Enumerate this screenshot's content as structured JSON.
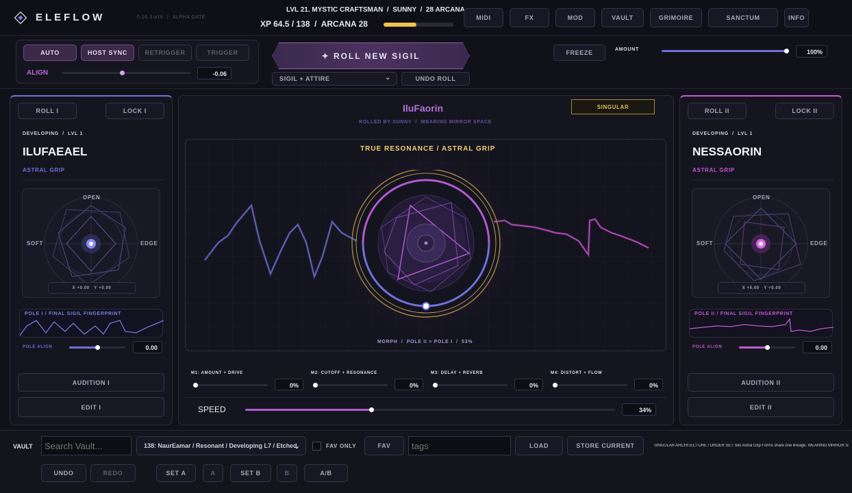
{
  "header": {
    "brand": "ELEFLOW",
    "version": "0.16.3-a16",
    "stage": "ALPHA GATE",
    "status_line": "LVL 21. MYSTIC CRAFTSMAN  /  SUNNY  /  28 ARCANA",
    "xp_line": "XP 64.5 / 138  /  ARCANA 28",
    "xp_progress": 0.467,
    "nav": [
      "MIDI",
      "FX",
      "MOD",
      "VAULT",
      "GRIMOIRE",
      "SANCTUM",
      "INFO"
    ]
  },
  "controls": {
    "auto": "AUTO",
    "host_sync": "HOST SYNC",
    "retrigger": "RETRIGGER",
    "trigger": "TRIGGER",
    "align_label": "ALIGN",
    "align_value": "-0.06",
    "align_level": 0.47,
    "roll_button": "✦ ROLL NEW SIGIL",
    "roll_mode": "SIGIL + ATTIRE",
    "undo_roll": "UNDO ROLL",
    "freeze": "FREEZE",
    "amount_label": "AMOUNT",
    "amount_value": "100%",
    "amount_level": 1.0
  },
  "pole_left": {
    "roll": "ROLL I",
    "lock": "LOCK I",
    "stage": "DEVELOPING  /  LVL 1",
    "name": "ILUFAEAEL",
    "form": "ASTRAL GRIP",
    "axis_top": "OPEN",
    "axis_left": "SOFT",
    "axis_right": "EDGE",
    "coords": "X +0.00   Y +0.00",
    "fingerprint_label": "POLE I / FINAL SIGIL FINGERPRINT",
    "pole_align_label": "POLE ALIGN",
    "pole_align_value": "0.00",
    "pole_align_level": 0.5,
    "audition": "AUDITION I",
    "edit": "EDIT I",
    "color": "#6f72d8"
  },
  "pole_right": {
    "roll": "ROLL II",
    "lock": "LOCK II",
    "stage": "DEVELOPING  /  LVL 1",
    "name": "NESSAORIN",
    "form": "ASTRAL GRIP",
    "axis_top": "OPEN",
    "axis_left": "SOFT",
    "axis_right": "EDGE",
    "coords": "X +0.00   Y +0.00",
    "fingerprint_label": "POLE II / FINAL SIGIL FINGERPRINT",
    "pole_align_label": "POLE ALIGN",
    "pole_align_value": "0.00",
    "pole_align_level": 0.5,
    "audition": "AUDITION II",
    "edit": "EDIT II",
    "color": "#c45ad2"
  },
  "center": {
    "title": "IluFaorin",
    "badge": "SINGULAR",
    "subtitle": "ROLLED BY SUNNY  /  WEARING MIRROR SPACE",
    "resonance": "TRUE RESONANCE / ASTRAL GRIP",
    "morph_line": "MORPH  /  POLE II > POLE I  /  53%",
    "morph_level": 0.53,
    "macros": [
      {
        "label": "M1: AMOUNT + DRIVE",
        "value": "0%",
        "level": 0
      },
      {
        "label": "M2: CUTOFF + RESONANCE",
        "value": "0%",
        "level": 0
      },
      {
        "label": "M3: DELAY + REVERB",
        "value": "0%",
        "level": 0
      },
      {
        "label": "M4: DISTORT + FLOW",
        "value": "0%",
        "level": 0
      }
    ],
    "speed_label": "SPEED",
    "speed_value": "34%",
    "speed_level": 0.34
  },
  "footer": {
    "vault_label": "VAULT",
    "search_placeholder": "Search Vault...",
    "preset": "138: NaurEamar / Resonant / Developing L7 / Etched",
    "fav_only": "FAV ONLY",
    "fav": "FAV",
    "tags_placeholder": "tags",
    "load": "LOAD",
    "store": "STORE CURRENT",
    "info": "SINGULAR ARCHITECTURE / ORDER SET: two Astral Grip Forms share one lineage. WEARING MIRROR SPACE.",
    "undo": "UNDO",
    "redo": "REDO",
    "set_a": "SET A",
    "a": "A",
    "set_b": "SET B",
    "b": "B",
    "ab": "A/B"
  },
  "colors": {
    "accent_blue": "#6f72d8",
    "accent_purple": "#c45ad2",
    "gold": "#e3bd58",
    "bg": "#111119"
  }
}
